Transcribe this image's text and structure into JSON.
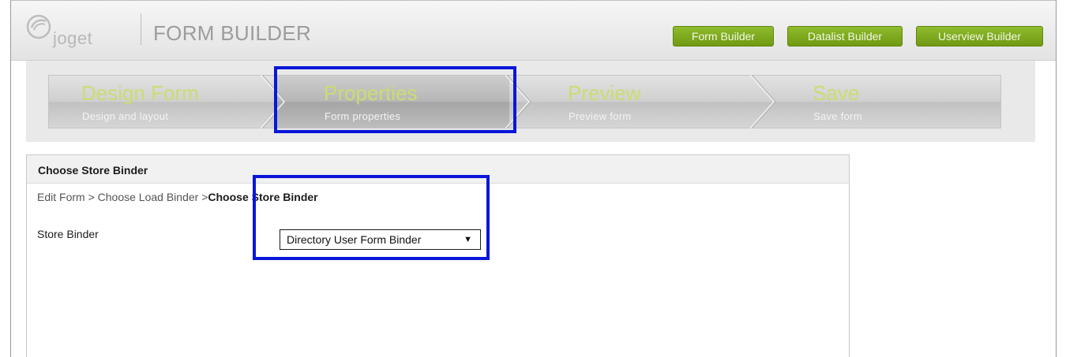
{
  "header": {
    "logo_text": "joget",
    "app_title": "FORM BUILDER",
    "buttons": [
      "Form Builder",
      "Datalist Builder",
      "Userview Builder"
    ]
  },
  "steps": [
    {
      "title": "Design Form",
      "subtitle": "Design and layout"
    },
    {
      "title": "Properties",
      "subtitle": "Form properties"
    },
    {
      "title": "Preview",
      "subtitle": "Preview form"
    },
    {
      "title": "Save",
      "subtitle": "Save form"
    }
  ],
  "panel": {
    "title": "Choose Store Binder",
    "breadcrumb": {
      "item1": "Edit Form",
      "sep": ">",
      "item2": "Choose Load Binder",
      "current": "Choose Store Binder"
    },
    "field_label": "Store Binder",
    "select_value": "Directory User Form Binder"
  },
  "colors": {
    "accent_green": "#7aa51c",
    "highlight_blue": "#0a16d8",
    "step_title": "#ccdc6f"
  }
}
